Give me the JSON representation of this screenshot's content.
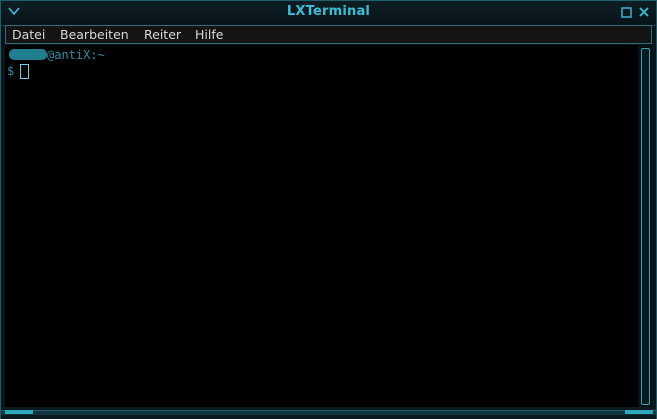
{
  "window": {
    "title": "LXTerminal"
  },
  "menubar": {
    "items": [
      {
        "label": "Datei"
      },
      {
        "label": "Bearbeiten"
      },
      {
        "label": "Reiter"
      },
      {
        "label": "Hilfe"
      }
    ]
  },
  "terminal": {
    "host_suffix": "@antiX:~",
    "prompt": "$"
  },
  "icons": {
    "title_arrow": "chevron-down-icon",
    "maximize": "maximize-icon",
    "close": "close-icon"
  },
  "colors": {
    "accent": "#39c0d8",
    "prompt_text": "#2e8fa0",
    "terminal_bg": "#000000"
  }
}
